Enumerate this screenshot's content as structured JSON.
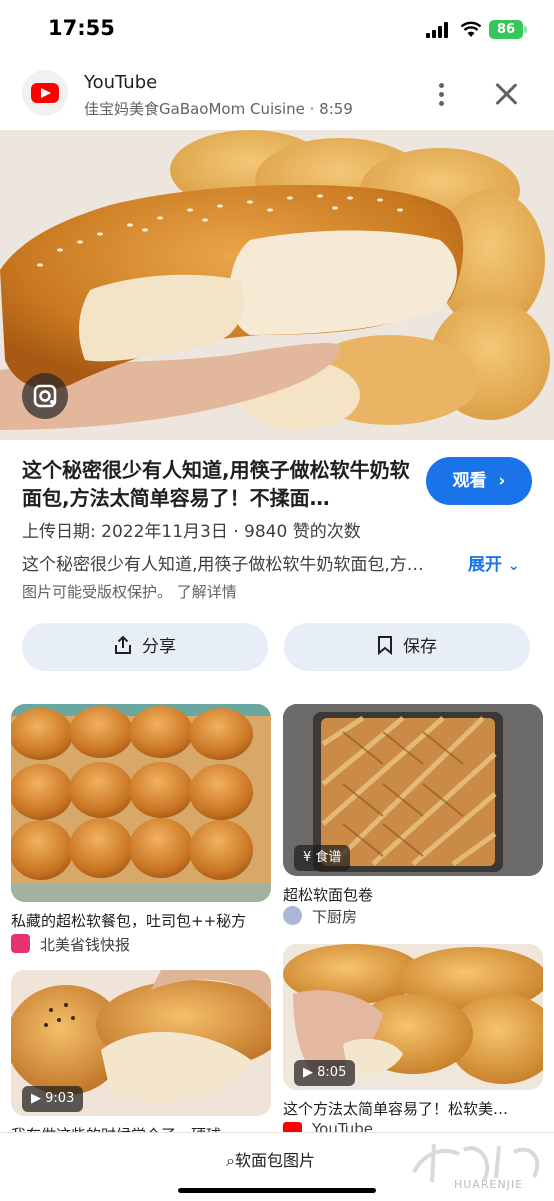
{
  "status_bar": {
    "time": "17:55",
    "battery": "86"
  },
  "header": {
    "app": "YouTube",
    "subtitle": "佳宝妈美食GaBaoMom Cuisine · 8:59"
  },
  "video": {
    "title": "这个秘密很少有人知道,用筷子做松软牛奶软面包,方法太简单容易了！不揉面…",
    "watch_label": "观看",
    "meta": "上传日期:   2022年11月3日  ·  9840 赞的次数",
    "description": "这个秘密很少有人知道,用筷子做松软牛奶软面包,方…",
    "expand_label": "展开",
    "copyright": "图片可能受版权保护。 了解详情"
  },
  "actions": {
    "share": "分享",
    "save": "保存"
  },
  "results": [
    {
      "title": "私藏的超松软餐包，吐司包++秘方",
      "source": "北美省钱快报",
      "badge": ""
    },
    {
      "title": "超松软面包卷",
      "source": "下厨房",
      "badge": "食谱"
    },
    {
      "title": "我在做这些的时候觉个了一硬球",
      "source": "",
      "badge": "9:03"
    },
    {
      "title": "这个方法太简单容易了！松软美…",
      "source": "YouTube",
      "badge": "8:05"
    }
  ],
  "bottom": {
    "search_chip": "软面包图片",
    "watermark": "HUARENJIE"
  },
  "colors": {
    "accent": "#1a73e8",
    "pill_bg": "#e8eef8",
    "youtube_red": "#ff0000"
  }
}
